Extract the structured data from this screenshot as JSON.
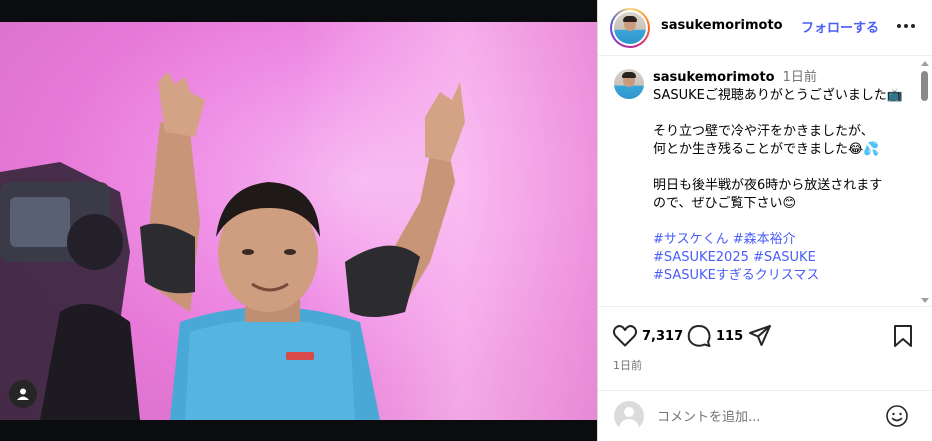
{
  "header": {
    "username": "sasukemorimoto",
    "follow_label": "フォローする"
  },
  "caption": {
    "username": "sasukemorimoto",
    "time": "1日前",
    "lines": [
      "SASUKEご視聴ありがとうございました📺",
      "",
      "そり立つ壁で冷や汗をかきましたが、",
      "何とか生き残ることができました😂💦",
      "",
      "明日も後半戦が夜6時から放送されます",
      "ので、ぜひご覧下さい😊",
      ""
    ],
    "hashtags": [
      "#サスケくん",
      "#森本裕介",
      "#SASUKE2025",
      "#SASUKE",
      "#SASUKEすぎるクリスマス"
    ]
  },
  "actions": {
    "likes": "7,317",
    "comments": "115"
  },
  "date": "1日前",
  "comment_box": {
    "placeholder": "コメントを追加..."
  },
  "colors": {
    "link": "#4a5df9",
    "muted": "#737373"
  },
  "icons": [
    "more-icon",
    "heart-icon",
    "comment-icon",
    "share-icon",
    "bookmark-icon",
    "emoji-icon",
    "user-tag-icon"
  ]
}
